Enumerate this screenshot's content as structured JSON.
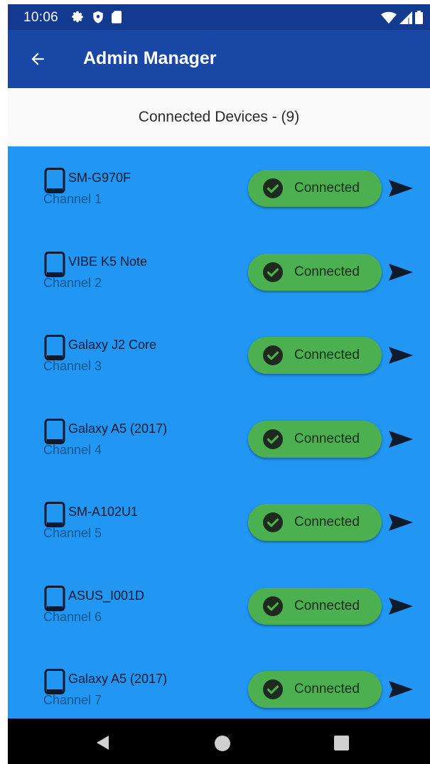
{
  "status_bar": {
    "time": "10:06",
    "left_icons": [
      "gear-icon",
      "shield-icon",
      "sd-card-icon"
    ],
    "right_icons": [
      "wifi-icon",
      "signal-icon",
      "battery-icon"
    ]
  },
  "app_bar": {
    "title": "Admin Manager",
    "back_icon": "arrow-left-icon"
  },
  "sub_header": {
    "title": "Connected Devices - (9)"
  },
  "devices": [
    {
      "name": "SM-G970F",
      "channel": "Channel 1",
      "status": "Connected"
    },
    {
      "name": "VIBE K5 Note",
      "channel": "Channel 2",
      "status": "Connected"
    },
    {
      "name": "Galaxy J2 Core",
      "channel": "Channel 3",
      "status": "Connected"
    },
    {
      "name": "Galaxy A5 (2017)",
      "channel": "Channel 4",
      "status": "Connected"
    },
    {
      "name": "SM-A102U1",
      "channel": "Channel 5",
      "status": "Connected"
    },
    {
      "name": "ASUS_I001D",
      "channel": "Channel 6",
      "status": "Connected"
    },
    {
      "name": "Galaxy A5 (2017)",
      "channel": "Channel 7",
      "status": "Connected"
    }
  ],
  "colors": {
    "status_bar": "#123b8f",
    "app_bar": "#1847a6",
    "list_background": "#2196f3",
    "connected_button": "#4caf50",
    "sub_header_background": "#fafafa"
  },
  "nav_bar": {
    "icons": [
      "nav-back-icon",
      "nav-home-icon",
      "nav-recents-icon"
    ]
  }
}
